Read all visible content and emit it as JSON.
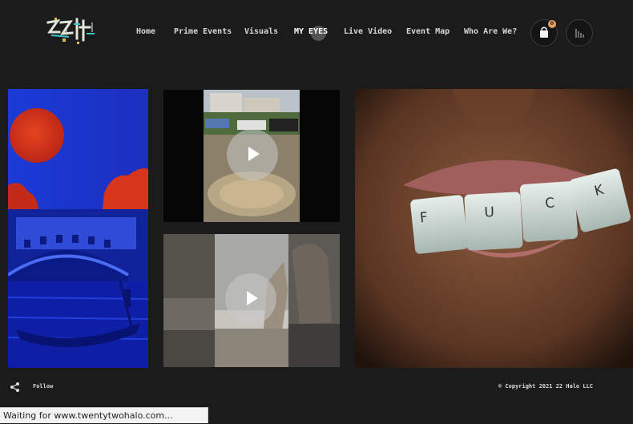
{
  "nav": {
    "items": [
      {
        "label": "Home"
      },
      {
        "label": "Prime Events"
      },
      {
        "label": "Visuals"
      },
      {
        "label": "MY EYES",
        "active": true
      },
      {
        "label": "Live Video"
      },
      {
        "label": "Event Map"
      },
      {
        "label": "Who Are We?"
      }
    ]
  },
  "cart": {
    "count": "0"
  },
  "icons": {
    "cart": "shopping-bag-icon",
    "audio": "audio-bars-icon",
    "share": "share-icon",
    "play": "play-icon"
  },
  "gallery": {
    "tile_keyboard_keys": [
      "F",
      "U",
      "C",
      "K"
    ]
  },
  "footer": {
    "follow_label": "Follow",
    "copyright": "© Copyright 2021  22 Halo LLC"
  },
  "status_bar": {
    "text": "Waiting for www.twentytwohalo.com..."
  },
  "colors": {
    "background": "#1b1b1b",
    "badge": "#e8a063",
    "venice_blue": "#1630c8",
    "sun_red": "#d2321f"
  }
}
